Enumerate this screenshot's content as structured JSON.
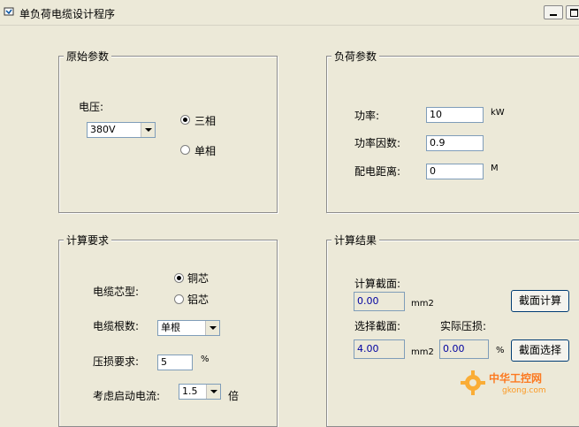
{
  "window": {
    "title": "单负荷电缆设计程序"
  },
  "original_params": {
    "group_title": "原始参数",
    "voltage_label": "电压:",
    "voltage_value": "380V",
    "phase_three": "三相",
    "phase_single": "单相",
    "selected_phase": "三相"
  },
  "load_params": {
    "group_title": "负荷参数",
    "power_label": "功率:",
    "power_value": "10",
    "power_unit": "kW",
    "pf_label": "功率因数:",
    "pf_value": "0.9",
    "distance_label": "配电距离:",
    "distance_value": "0",
    "distance_unit": "M"
  },
  "requirements": {
    "group_title": "计算要求",
    "core_label": "电缆芯型:",
    "core_copper": "铜芯",
    "core_aluminum": "铝芯",
    "selected_core": "铜芯",
    "count_label": "电缆根数:",
    "count_value": "单根",
    "drop_label": "压损要求:",
    "drop_value": "5",
    "drop_unit": "%",
    "start_label": "考虑启动电流:",
    "start_value": "1.5",
    "start_unit": "倍"
  },
  "results": {
    "group_title": "计算结果",
    "calc_section_label": "计算截面:",
    "calc_section_value": "0.00",
    "calc_section_unit": "mm2",
    "calc_button": "截面计算",
    "select_section_label": "选择截面:",
    "select_section_value": "4.00",
    "select_section_unit": "mm2",
    "actual_drop_label": "实际压损:",
    "actual_drop_value": "0.00",
    "actual_drop_unit": "%",
    "select_button": "截面选择"
  },
  "watermark": {
    "brand": "中华工控网",
    "url": "gkong.com"
  },
  "colors": {
    "window_bg": "#ece9d8",
    "readonly_text": "#0000a0",
    "watermark": "#ff6600"
  }
}
